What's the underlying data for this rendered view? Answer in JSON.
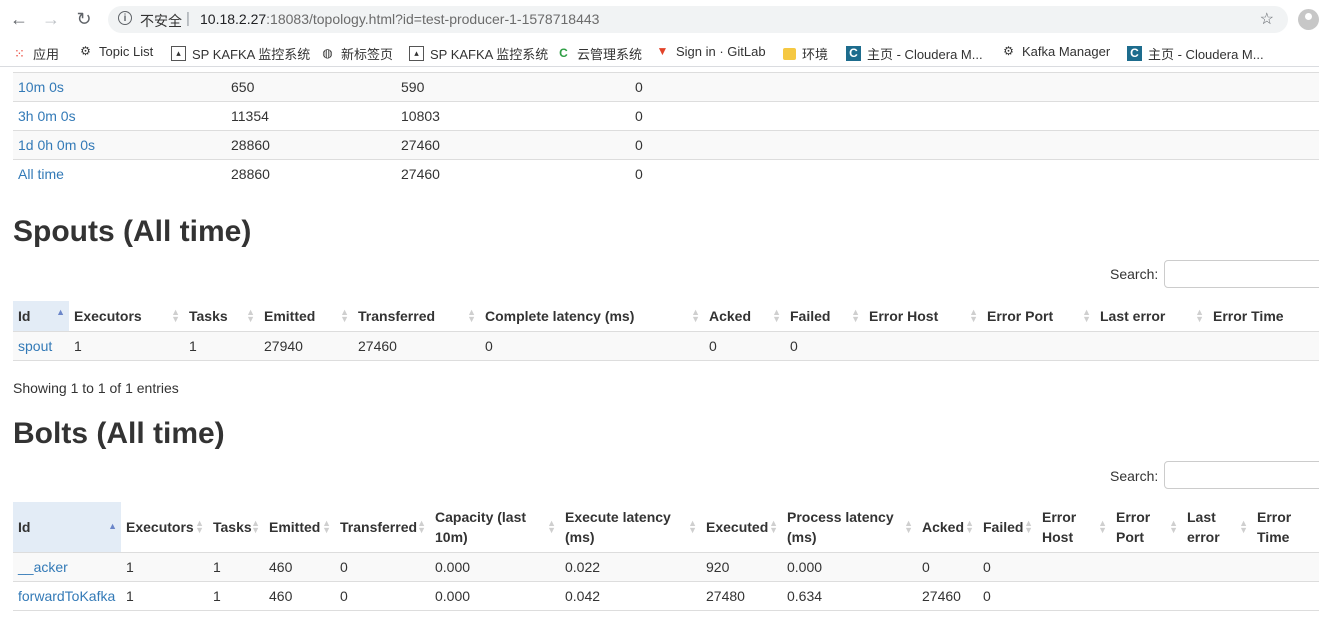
{
  "browser": {
    "security_label": "不安全",
    "url_host": "10.18.2.27",
    "url_rest": ":18083/topology.html?id=test-producer-1-1578718443"
  },
  "bookmarks": [
    {
      "label": "应用",
      "icon": "apps-grid-icon"
    },
    {
      "label": "Topic List",
      "icon": "kafka-icon"
    },
    {
      "label": "SP KAFKA 监控系统",
      "icon": "page-icon"
    },
    {
      "label": "新标签页",
      "icon": "globe-icon"
    },
    {
      "label": "SP KAFKA 监控系统",
      "icon": "page-icon"
    },
    {
      "label": "云管理系统",
      "icon": "cloud-icon"
    },
    {
      "label": "Sign in · GitLab",
      "icon": "gitlab-icon"
    },
    {
      "label": "环境",
      "icon": "folder-icon"
    },
    {
      "label": "主页 - Cloudera M...",
      "icon": "cloudera-icon"
    },
    {
      "label": "Kafka Manager",
      "icon": "kafka-icon"
    },
    {
      "label": "主页 - Cloudera M...",
      "icon": "cloudera-icon"
    }
  ],
  "stats_rows": [
    [
      "10m 0s",
      "650",
      "590",
      "0"
    ],
    [
      "3h 0m 0s",
      "11354",
      "10803",
      "0"
    ],
    [
      "1d 0h 0m 0s",
      "28860",
      "27460",
      "0"
    ],
    [
      "All time",
      "28860",
      "27460",
      "0"
    ]
  ],
  "spouts": {
    "title": "Spouts (All time)",
    "search_label": "Search:",
    "headers": [
      "Id",
      "Executors",
      "Tasks",
      "Emitted",
      "Transferred",
      "Complete latency (ms)",
      "Acked",
      "Failed",
      "Error Host",
      "Error Port",
      "Last error",
      "Error Time"
    ],
    "rows": [
      [
        "spout",
        "1",
        "1",
        "27940",
        "27460",
        "0",
        "0",
        "0",
        "",
        "",
        "",
        ""
      ]
    ],
    "showing": "Showing 1 to 1 of 1 entries"
  },
  "bolts": {
    "title": "Bolts (All time)",
    "search_label": "Search:",
    "headers": [
      "Id",
      "Executors",
      "Tasks",
      "Emitted",
      "Transferred",
      "Capacity (last 10m)",
      "Execute latency (ms)",
      "Executed",
      "Process latency (ms)",
      "Acked",
      "Failed",
      "Error Host",
      "Error Port",
      "Last error",
      "Error Time"
    ],
    "rows": [
      [
        "__acker",
        "1",
        "1",
        "460",
        "0",
        "0.000",
        "0.022",
        "920",
        "0.000",
        "0",
        "0",
        "",
        "",
        "",
        ""
      ],
      [
        "forwardToKafka",
        "1",
        "1",
        "460",
        "0",
        "0.000",
        "0.042",
        "27480",
        "0.634",
        "27460",
        "0",
        "",
        "",
        "",
        ""
      ]
    ]
  }
}
